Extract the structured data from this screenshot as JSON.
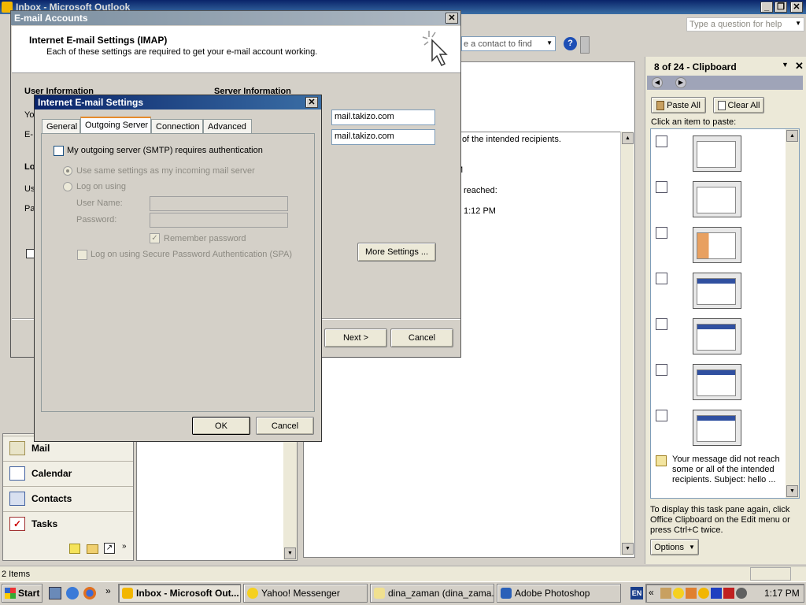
{
  "outlook": {
    "title": "Inbox - Microsoft Outlook",
    "help_placeholder": "Type a question for help",
    "contact_placeholder": "e a contact to find",
    "status_items": "2 Items",
    "preview_lines": [
      "ll of the intended recipients.",
      "M",
      "reached:",
      "1:12 PM"
    ]
  },
  "nav": {
    "mail": "Mail",
    "calendar": "Calendar",
    "contacts": "Contacts",
    "tasks": "Tasks"
  },
  "clipboard": {
    "title": "8 of 24 - Clipboard",
    "paste_all": "Paste All",
    "clear_all": "Clear All",
    "click_hint": "Click an item to paste:",
    "text_item": "Your message did not reach some or all of the intended recipients. Subject: hello ...",
    "footer": "To display this task pane again, click Office Clipboard on the Edit menu or press Ctrl+C twice.",
    "options": "Options"
  },
  "accounts_dialog": {
    "title": "E-mail Accounts",
    "heading": "Internet E-mail Settings (IMAP)",
    "subheading": "Each of these settings are required to get your e-mail account working.",
    "user_info": "User Information",
    "server_info": "Server Information",
    "incoming_server": "mail.takizo.com",
    "outgoing_server": "mail.takizo.com",
    "partial_labels": [
      "Yo",
      "E-",
      "Lo",
      "Us",
      "Pa"
    ],
    "more_settings": "More Settings ...",
    "next": "Next >",
    "cancel": "Cancel"
  },
  "settings_dialog": {
    "title": "Internet E-mail Settings",
    "tabs": [
      "General",
      "Outgoing Server",
      "Connection",
      "Advanced"
    ],
    "smtp_auth": "My outgoing server (SMTP) requires authentication",
    "use_same": "Use same settings as my incoming mail server",
    "log_on_using": "Log on using",
    "user_name": "User Name:",
    "password": "Password:",
    "remember": "Remember password",
    "spa": "Log on using Secure Password Authentication (SPA)",
    "ok": "OK",
    "cancel": "Cancel"
  },
  "taskbar": {
    "start": "Start",
    "tasks": [
      "Inbox - Microsoft Out...",
      "Yahoo! Messenger",
      "dina_zaman  (dina_zama...",
      "Adobe Photoshop"
    ],
    "lang": "EN",
    "clock": "1:17 PM"
  }
}
